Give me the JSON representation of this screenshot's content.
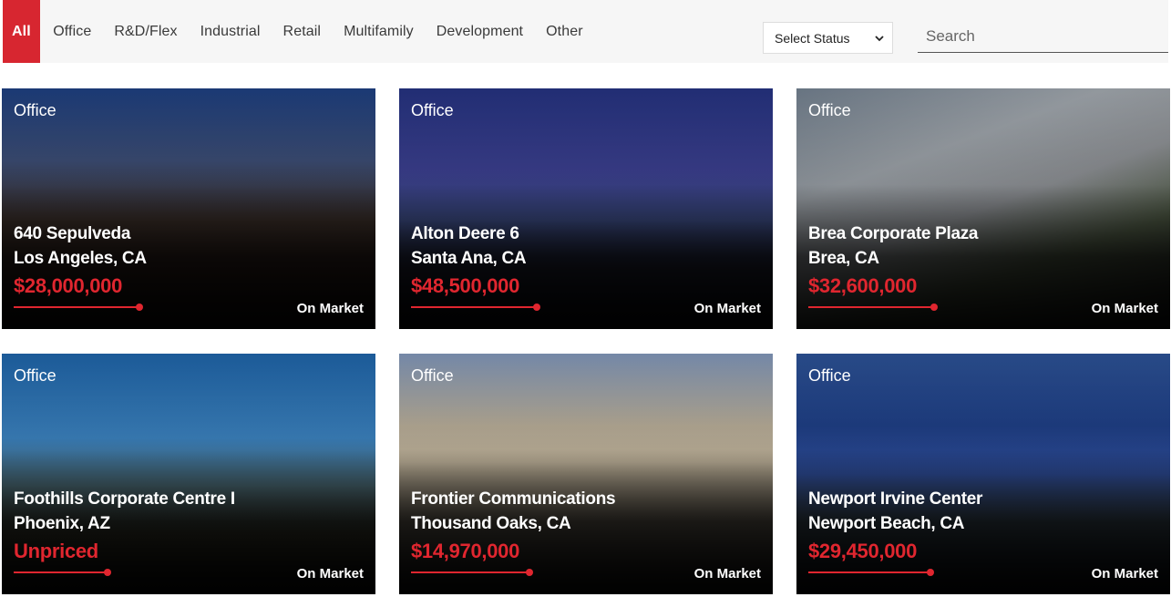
{
  "filters": {
    "tabs": [
      "All",
      "Office",
      "R&D/Flex",
      "Industrial",
      "Retail",
      "Multifamily",
      "Development",
      "Other"
    ],
    "active": "All",
    "status_select": "Select Status",
    "search_placeholder": "Search"
  },
  "colors": {
    "accent": "#d72630",
    "price": "#e0262f"
  },
  "listings": [
    {
      "type": "Office",
      "name": "640 Sepulveda",
      "city": "Los Angeles, CA",
      "price": "$28,000,000",
      "status": "On Market",
      "bg": "linear-gradient(180deg,#1c3c7a 0%,#3b4c73 30%,#3a2e28 55%,#2a1d18 75%,#120c0a 100%)"
    },
    {
      "type": "Office",
      "name": "Alton Deere 6",
      "city": "Santa Ana, CA",
      "price": "$48,500,000",
      "status": "On Market",
      "bg": "linear-gradient(180deg,#23307a 0%,#3b3f8e 35%,#3d4d86 55%,#1e2030 75%,#0a0a10 100%)"
    },
    {
      "type": "Office",
      "name": "Brea Corporate Plaza",
      "city": "Brea, CA",
      "price": "$32,600,000",
      "status": "On Market",
      "bg": "linear-gradient(160deg,#6d7a88 0%,#9aa0a6 30%,#8c8f93 50%,#4f5a45 70%,#151515 100%)"
    },
    {
      "type": "Office",
      "name": "Foothills Corporate Centre I",
      "city": "Phoenix, AZ",
      "price": "Unpriced",
      "status": "On Market",
      "bg": "linear-gradient(180deg,#1d5fa0 0%,#3b82bf 35%,#4f6f7a 55%,#3a3a2c 75%,#0d0d0b 100%)"
    },
    {
      "type": "Office",
      "name": "Frontier Communications",
      "city": "Thousand Oaks, CA",
      "price": "$14,970,000",
      "status": "On Market",
      "bg": "linear-gradient(180deg,#7a8fb0 0%,#b8ad98 30%,#c4b79e 45%,#6b6457 68%,#141312 100%)"
    },
    {
      "type": "Office",
      "name": "Newport Irvine Center",
      "city": "Newport Beach, CA",
      "price": "$29,450,000",
      "status": "On Market",
      "bg": "linear-gradient(180deg,#2a4e8e 0%,#1f3f86 30%,#3050a0 50%,#3b4a55 70%,#0c0e12 100%)"
    }
  ]
}
